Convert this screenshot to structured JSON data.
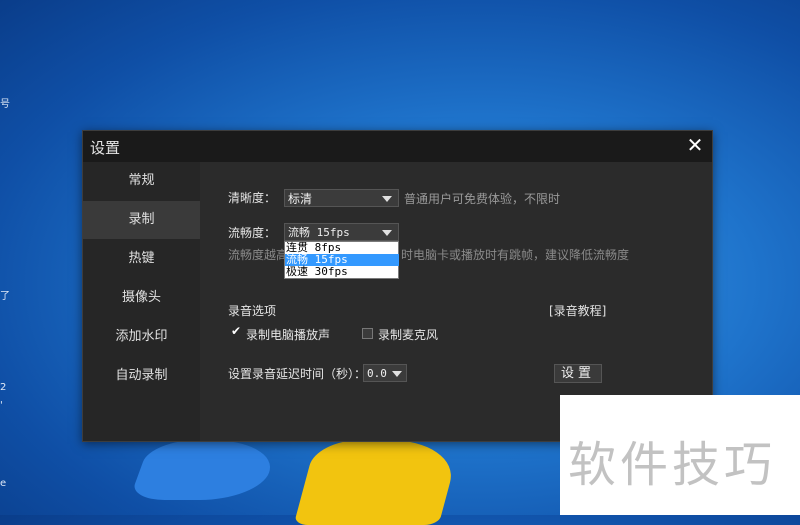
{
  "desktop": {
    "edge_marks": [
      "号",
      "了",
      "2",
      "'",
      "e"
    ]
  },
  "dialog": {
    "title": "设置",
    "close_glyph": "✕",
    "sidebar": {
      "items": [
        {
          "label": "常规",
          "active": false
        },
        {
          "label": "录制",
          "active": true
        },
        {
          "label": "热键",
          "active": false
        },
        {
          "label": "摄像头",
          "active": false
        },
        {
          "label": "添加水印",
          "active": false
        },
        {
          "label": "自动录制",
          "active": false
        }
      ]
    },
    "clarity": {
      "label": "清晰度：",
      "value": "标清",
      "note": "普通用户可免费体验，不限时"
    },
    "fluency": {
      "label": "流畅度：",
      "value": "流畅 15fps",
      "hint_left": "流畅度越高",
      "hint_right": "时电脑卡或播放时有跳帧，建议降低流畅度",
      "options": [
        {
          "label": "连贯 8fps",
          "selected": false
        },
        {
          "label": "流畅 15fps",
          "selected": true
        },
        {
          "label": "极速 30fps",
          "selected": false
        }
      ]
    },
    "audio": {
      "section_label": "录音选项",
      "tutorial_link": "[录音教程]",
      "record_system": {
        "label": "录制电脑播放声",
        "checked": true
      },
      "record_mic": {
        "label": "录制麦克风",
        "checked": false
      },
      "delay_label": "设置录音延迟时间（秒）：",
      "delay_value": "0.0",
      "set_button": "设置"
    }
  },
  "watermark": {
    "text": "软件技巧"
  },
  "colors": {
    "dialog_bg": "#2b2b2b",
    "titlebar_bg": "#1a1a1a",
    "selection": "#3399ff"
  }
}
